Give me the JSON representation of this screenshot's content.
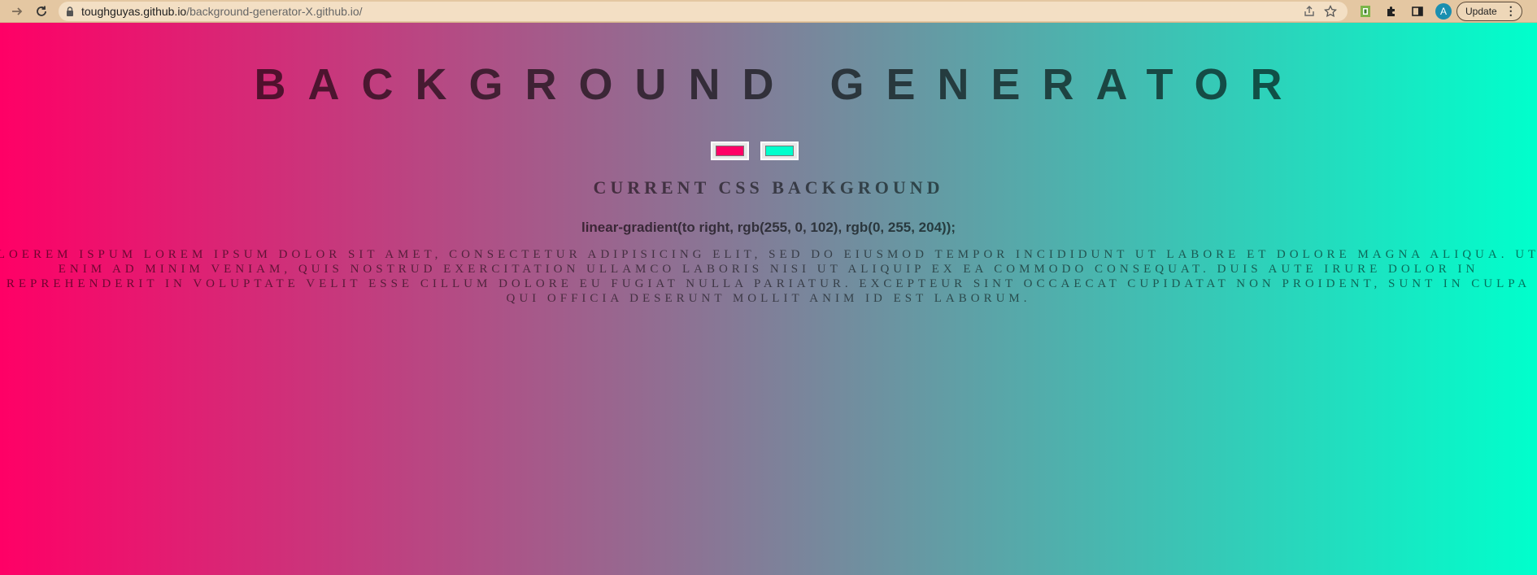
{
  "browser": {
    "url_host": "toughguyas.github.io",
    "url_path": "/background-generator-X.github.io/",
    "avatar_letter": "A",
    "update_label": "Update"
  },
  "page": {
    "title": "BACKGROUND GENERATOR",
    "subtitle": "CURRENT CSS BACKGROUND",
    "color1": "#ff0066",
    "color2": "#00ffcc",
    "css_value": "linear-gradient(to right, rgb(255, 0, 102), rgb(0, 255, 204));",
    "paragraph": "Loerem ispum Lorem ipsum dolor sit amet, consectetur adipisicing elit, sed do eiusmod tempor incididunt ut labore et dolore magna aliqua. Ut enim ad minim veniam, quis nostrud exercitation ullamco laboris nisi ut aliquip ex ea commodo consequat. Duis aute irure dolor in reprehenderit in voluptate velit esse cillum dolore eu fugiat nulla pariatur. Excepteur sint occaecat cupidatat non proident, sunt in culpa qui officia deserunt mollit anim id est laborum."
  },
  "icons": {
    "forward": "forward-icon",
    "reload": "reload-icon",
    "lock": "lock-icon",
    "share": "share-icon",
    "star": "star-icon",
    "extension_green": "extension-icon",
    "puzzle": "puzzle-icon",
    "side_panel": "side-panel-icon",
    "menu": "menu-icon"
  }
}
